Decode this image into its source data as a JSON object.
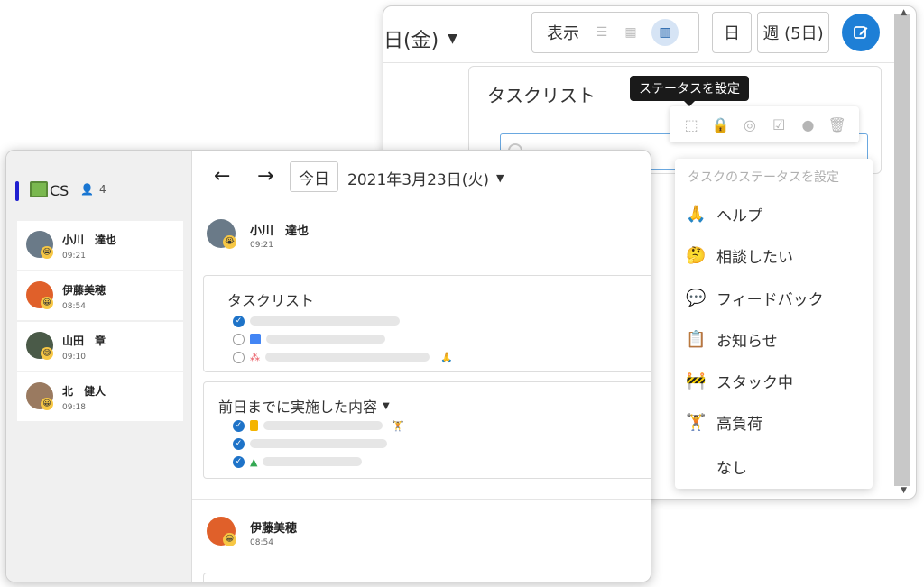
{
  "back_window": {
    "date_fragment": "日(金)",
    "view_label": "表示",
    "day_button": "日",
    "week_button": "週 (5日)",
    "card_title": "タスクリスト",
    "tooltip": "ステータスを設定",
    "status_menu": {
      "header": "タスクのステータスを設定",
      "items": [
        {
          "emoji": "🙏",
          "label": "ヘルプ"
        },
        {
          "emoji": "🤔",
          "label": "相談したい"
        },
        {
          "emoji": "💬",
          "label": "フィードバック"
        },
        {
          "emoji": "📋",
          "label": "お知らせ"
        },
        {
          "emoji": "🚧",
          "label": "スタック中"
        },
        {
          "emoji": "🏋",
          "label": "高負荷"
        },
        {
          "emoji": "",
          "label": "なし"
        }
      ]
    }
  },
  "front_window": {
    "team": {
      "name": "CS",
      "member_count": "4"
    },
    "members": [
      {
        "name": "小川　達也",
        "time": "09:21",
        "avatar_color": "#6a7a88",
        "face": "😭"
      },
      {
        "name": "伊藤美穂",
        "time": "08:54",
        "avatar_color": "#e0602a",
        "face": "😀"
      },
      {
        "name": "山田　章",
        "time": "09:10",
        "avatar_color": "#4a5a48",
        "face": "😅"
      },
      {
        "name": "北　健人",
        "time": "09:18",
        "avatar_color": "#9a7a60",
        "face": "😀"
      }
    ],
    "toolbar": {
      "today": "今日",
      "date": "2021年3月23日(火)"
    },
    "posts": [
      {
        "name": "小川　達也",
        "time": "09:21"
      },
      {
        "name": "伊藤美穂",
        "time": "08:54"
      }
    ],
    "tasklist_title": "タスクリスト",
    "done_title": "前日までに実施した内容"
  },
  "colors": {
    "accent": "#1e7fd6",
    "check": "#1e73c8",
    "team_bar": "#2020d0"
  }
}
